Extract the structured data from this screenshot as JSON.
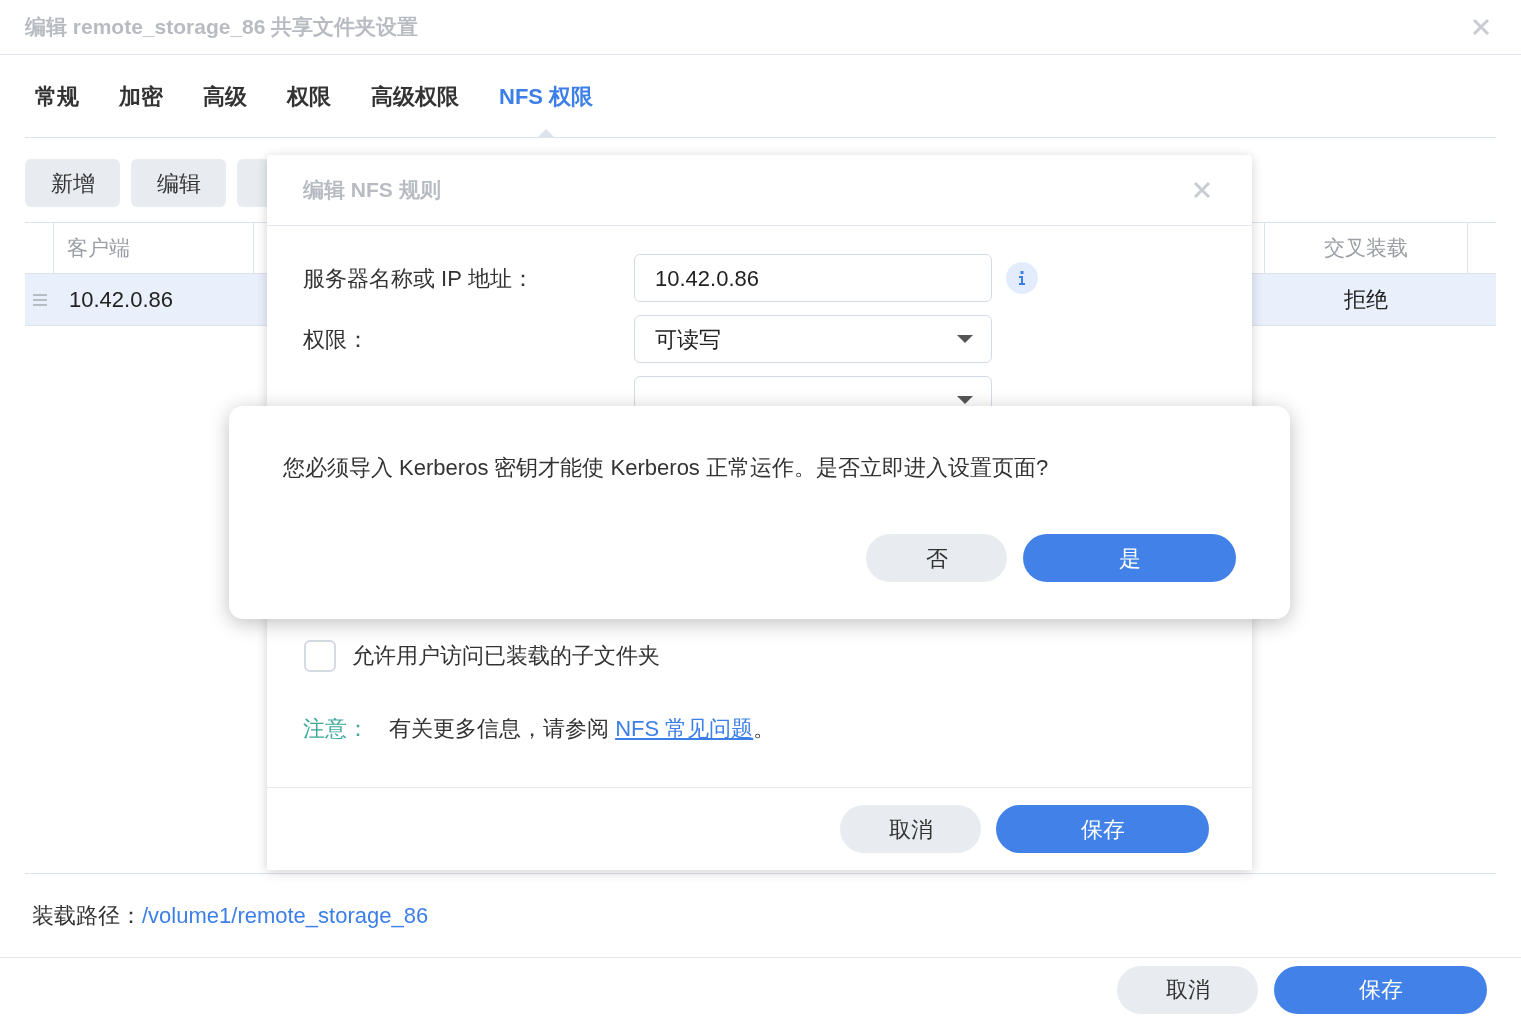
{
  "window": {
    "title": "编辑 remote_storage_86 共享文件夹设置"
  },
  "tabs": [
    {
      "label": "常规",
      "selected": false
    },
    {
      "label": "加密",
      "selected": false
    },
    {
      "label": "高级",
      "selected": false
    },
    {
      "label": "权限",
      "selected": false
    },
    {
      "label": "高级权限",
      "selected": false
    },
    {
      "label": "NFS 权限",
      "selected": true
    }
  ],
  "toolbar": {
    "buttons": [
      "新增",
      "编辑"
    ]
  },
  "table": {
    "columns": [
      "客户端",
      "交叉装载"
    ],
    "rows": [
      {
        "cells": [
          "10.42.0.86",
          "拒绝"
        ],
        "selected": true
      }
    ]
  },
  "mount_path": {
    "label": "装载路径：",
    "value": "/volume1/remote_storage_86"
  },
  "buttons": [
    {
      "label": "取消",
      "primary": false
    },
    {
      "label": "保存",
      "primary": true
    }
  ],
  "nfs_dialog": {
    "title": "编辑 NFS 规则",
    "fields": [
      {
        "label": "服务器名称或 IP 地址：",
        "kind": "text",
        "value": "10.42.0.86",
        "info": true
      },
      {
        "label": "权限：",
        "kind": "select",
        "value": "可读写",
        "info": false
      },
      {
        "kind": "select",
        "info": false
      }
    ],
    "checkbox": {
      "label": "允许用户访问已装载的子文件夹",
      "checked": false
    },
    "note": {
      "label": "注意：",
      "text": "有关更多信息，请参阅 ",
      "link": "NFS 常见问题",
      "suffix": "。"
    },
    "buttons": [
      {
        "label": "取消",
        "primary": false
      },
      {
        "label": "保存",
        "primary": true
      }
    ]
  },
  "confirm": {
    "message": "您必须导入 Kerberos 密钥才能使 Kerberos 正常运作。是否立即进入设置页面?",
    "buttons": [
      {
        "label": "否",
        "primary": false
      },
      {
        "label": "是",
        "primary": true
      }
    ]
  }
}
